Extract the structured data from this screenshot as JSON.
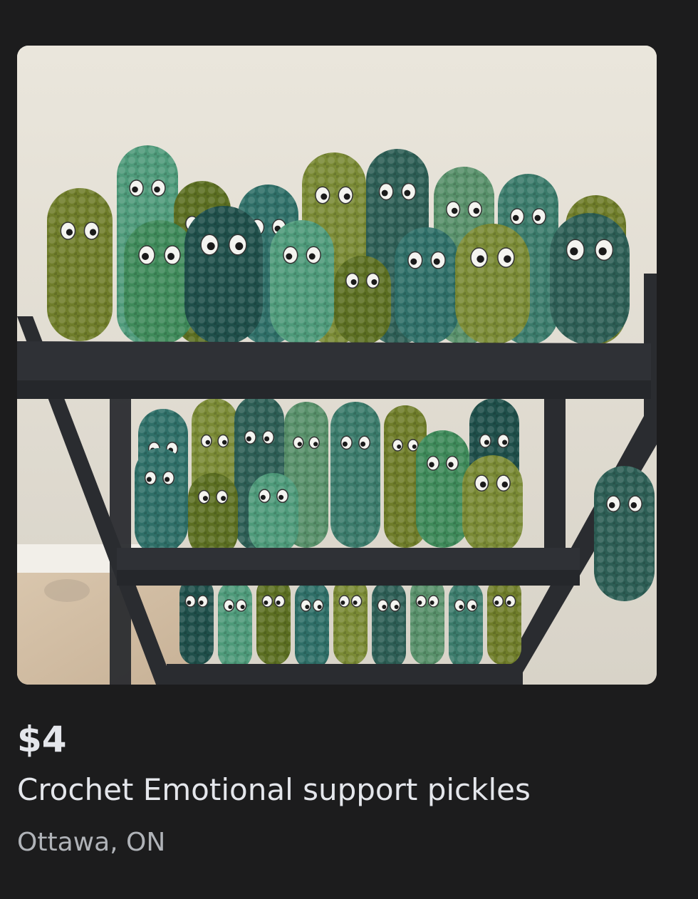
{
  "listing": {
    "image_icon": "listing-photo",
    "price": "$4",
    "title": "Crochet Emotional support pickles",
    "location": "Ottawa, ON"
  },
  "colors": {
    "background": "#1c1c1d",
    "primary_text": "#e4e6eb",
    "secondary_text": "#b0b3b8"
  }
}
